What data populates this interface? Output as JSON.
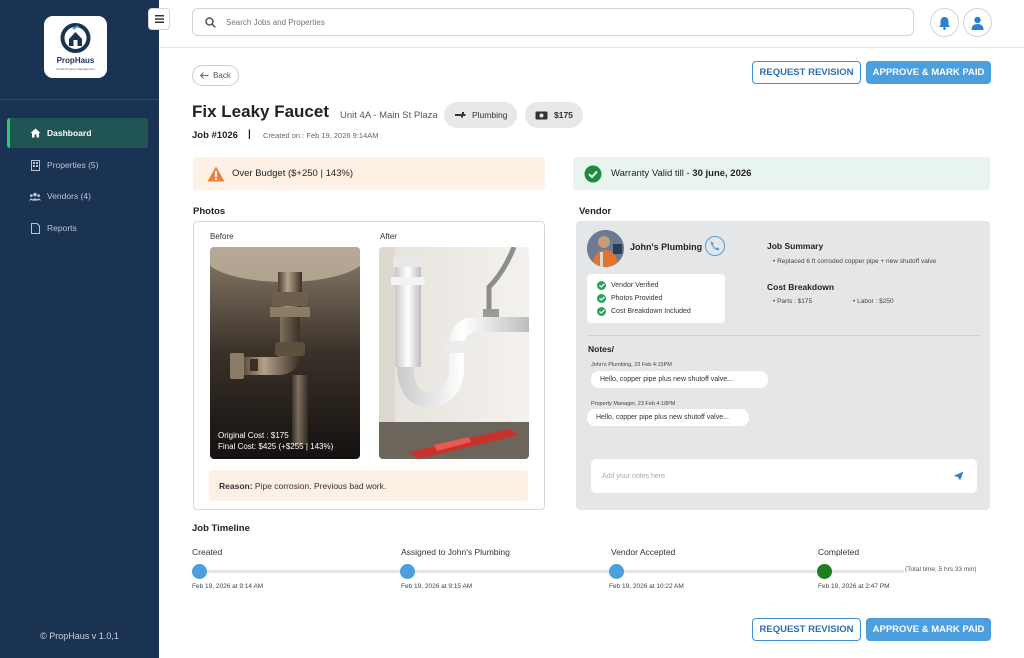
{
  "brand": {
    "name": "PropHaus",
    "tagline": "Smart Property Management"
  },
  "sidebar": {
    "items": [
      {
        "label": "Dashboard",
        "icon": "home-icon",
        "active": true
      },
      {
        "label": "Properties (5)",
        "icon": "building-icon"
      },
      {
        "label": "Vendors (4)",
        "icon": "users-icon"
      },
      {
        "label": "Reports",
        "icon": "document-icon"
      }
    ],
    "version": "© PropHaus v 1.0,1"
  },
  "search": {
    "placeholder": "Search Jobs and Properties"
  },
  "actions": {
    "back": "Back",
    "request_revision": "REQUEST REVISION",
    "approve": "APPROVE & MARK PAID"
  },
  "job": {
    "title": "Fix Leaky Faucet",
    "location": "Unit 4A - Main St Plaza",
    "category": "Plumbing",
    "amount": "$175",
    "number": "Job #1026",
    "separator": "|",
    "created": "Created on : Feb 19, 2026 9:14AM"
  },
  "alerts": {
    "budget": "Over Budget ($+250 | 143%)",
    "warranty_prefix": "Warranty Valid till - ",
    "warranty_date": "30 june, 2026"
  },
  "photos": {
    "section": "Photos",
    "before_label": "Before",
    "after_label": "After",
    "original_cost": "Original Cost : $175",
    "final_cost": "Final Cost: $425 (+$255 | 143%)",
    "reason_label": "Reason:",
    "reason_text": " Pipe corrosion. Previous bad work."
  },
  "vendor": {
    "section": "Vendor",
    "name": "John's Plumbing",
    "checks": [
      "Vendor Verified",
      "Photos Provided",
      "Cost Breakdown Included"
    ],
    "summary_title": "Job Summary",
    "summary_item": "Replaced 6 ft corroded copper pipe + new shutoff valve",
    "cost_title": "Cost Breakdown",
    "parts": "Parts : $175",
    "labor": "Labor : $250",
    "notes_title": "Notes/",
    "notes": [
      {
        "meta": "John's Plumbing, 23 Feb 4:15PM",
        "text": "Hello, copper pipe plus new shutoff valve..."
      },
      {
        "meta": "Property Manager, 23 Feb 4:18PM",
        "text": "Hello, copper pipe plus new shutoff valve..."
      }
    ],
    "notes_placeholder": "Add your notes here"
  },
  "timeline": {
    "section": "Job Timeline",
    "steps": [
      {
        "label": "Created",
        "date": "Feb 19, 2026 at 9:14 AM",
        "color": "#4c9fdf"
      },
      {
        "label": "Assigned to John's Plumbing",
        "date": "Feb 19, 2026 at 9:15 AM",
        "color": "#4c9fdf"
      },
      {
        "label": "Vendor Accepted",
        "date": "Feb 19, 2026 at 10:22 AM",
        "color": "#4c9fdf"
      },
      {
        "label": "Completed",
        "date": "Feb 19, 2026 at 2:47 PM",
        "color": "#1e7d1e"
      }
    ],
    "total": "(Total time; 5 hrs 33 min)"
  },
  "colors": {
    "sidebar": "#1b3353",
    "accent": "#4c9fdf",
    "success": "#27a35a",
    "warning": "#f07f3c"
  }
}
